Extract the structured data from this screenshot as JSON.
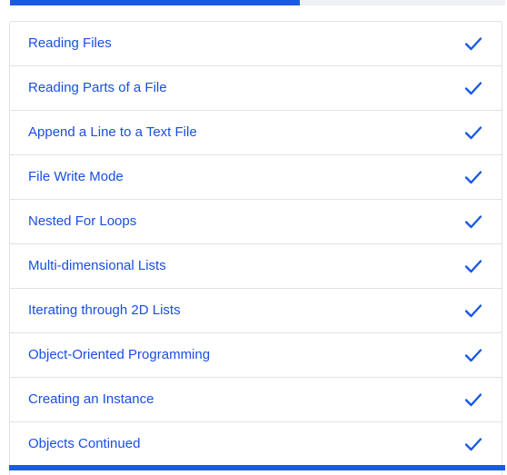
{
  "progress": {
    "fraction": 0.585,
    "fill_color": "#1a5ae5",
    "track_color": "#eef0f3"
  },
  "lessons": [
    {
      "label": "Reading Files",
      "completed": true,
      "icon": "checkmark-icon"
    },
    {
      "label": "Reading Parts of a File",
      "completed": true,
      "icon": "checkmark-icon"
    },
    {
      "label": "Append a Line to a Text File",
      "completed": true,
      "icon": "checkmark-icon"
    },
    {
      "label": "File Write Mode",
      "completed": true,
      "icon": "checkmark-icon"
    },
    {
      "label": "Nested For Loops",
      "completed": true,
      "icon": "checkmark-icon"
    },
    {
      "label": "Multi-dimensional Lists",
      "completed": true,
      "icon": "checkmark-icon"
    },
    {
      "label": "Iterating through 2D Lists",
      "completed": true,
      "icon": "checkmark-icon"
    },
    {
      "label": "Object-Oriented Programming",
      "completed": true,
      "icon": "checkmark-icon"
    },
    {
      "label": "Creating an Instance",
      "completed": true,
      "icon": "checkmark-icon"
    },
    {
      "label": "Objects Continued",
      "completed": true,
      "icon": "checkmark-icon"
    }
  ],
  "colors": {
    "link_text": "#1a4fe0",
    "check": "#1a5ae5",
    "border": "#dfe2e7"
  }
}
